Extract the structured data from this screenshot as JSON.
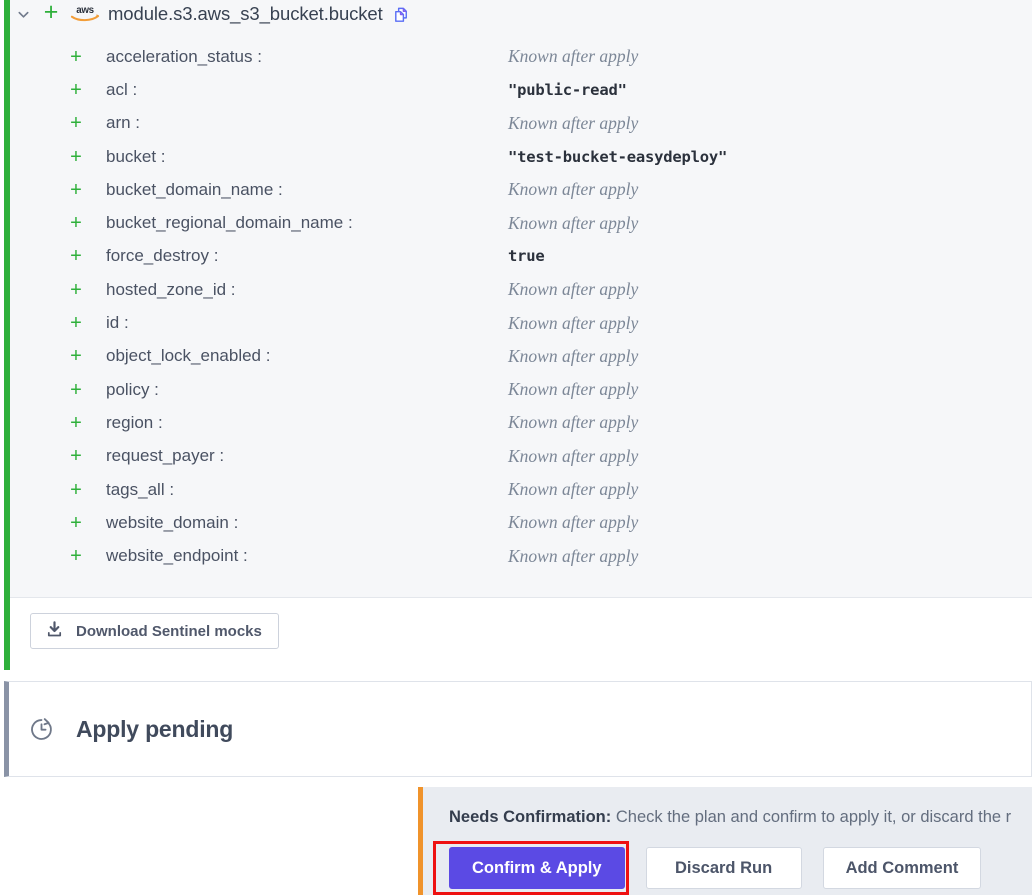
{
  "resource": {
    "chevron_icon": "chevron-down-icon",
    "change_marker": "+",
    "provider_icon": "aws-logo-icon",
    "provider_label": "aws",
    "name": "module.s3.aws_s3_bucket.bucket",
    "copy_icon": "copy-icon",
    "attributes": [
      {
        "marker": "+",
        "key": "acceleration_status :",
        "value": "Known after apply",
        "value_kind": "unknown"
      },
      {
        "marker": "+",
        "key": "acl :",
        "value": "\"public-read\"",
        "value_kind": "literal"
      },
      {
        "marker": "+",
        "key": "arn :",
        "value": "Known after apply",
        "value_kind": "unknown"
      },
      {
        "marker": "+",
        "key": "bucket :",
        "value": "\"test-bucket-easydeploy\"",
        "value_kind": "literal"
      },
      {
        "marker": "+",
        "key": "bucket_domain_name :",
        "value": "Known after apply",
        "value_kind": "unknown"
      },
      {
        "marker": "+",
        "key": "bucket_regional_domain_name :",
        "value": "Known after apply",
        "value_kind": "unknown"
      },
      {
        "marker": "+",
        "key": "force_destroy :",
        "value": "true",
        "value_kind": "literal"
      },
      {
        "marker": "+",
        "key": "hosted_zone_id :",
        "value": "Known after apply",
        "value_kind": "unknown"
      },
      {
        "marker": "+",
        "key": "id :",
        "value": "Known after apply",
        "value_kind": "unknown"
      },
      {
        "marker": "+",
        "key": "object_lock_enabled :",
        "value": "Known after apply",
        "value_kind": "unknown"
      },
      {
        "marker": "+",
        "key": "policy :",
        "value": "Known after apply",
        "value_kind": "unknown"
      },
      {
        "marker": "+",
        "key": "region :",
        "value": "Known after apply",
        "value_kind": "unknown"
      },
      {
        "marker": "+",
        "key": "request_payer :",
        "value": "Known after apply",
        "value_kind": "unknown"
      },
      {
        "marker": "+",
        "key": "tags_all :",
        "value": "Known after apply",
        "value_kind": "unknown"
      },
      {
        "marker": "+",
        "key": "website_domain :",
        "value": "Known after apply",
        "value_kind": "unknown"
      },
      {
        "marker": "+",
        "key": "website_endpoint :",
        "value": "Known after apply",
        "value_kind": "unknown"
      }
    ],
    "footer": {
      "download_icon": "download-icon",
      "download_label": "Download Sentinel mocks"
    },
    "accent_color": "#2fb03b"
  },
  "apply_section": {
    "status_icon": "clock-pending-icon",
    "title": "Apply pending",
    "accent_color": "#8a93a6"
  },
  "confirm_bar": {
    "notice_label": "Needs Confirmation:",
    "notice_text": " Check the plan and confirm to apply it, or discard the r",
    "accent_color": "#f0932b",
    "buttons": {
      "confirm": "Confirm & Apply",
      "discard": "Discard Run",
      "comment": "Add Comment"
    },
    "primary_color": "#5b4ae4",
    "highlight_color": "#ee1111"
  }
}
